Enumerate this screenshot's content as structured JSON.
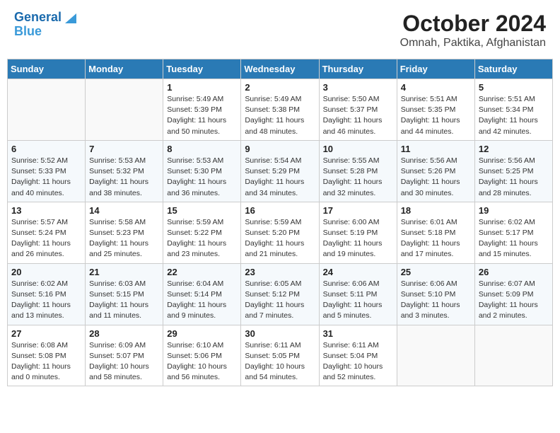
{
  "header": {
    "logo_line1": "General",
    "logo_line2": "Blue",
    "title": "October 2024",
    "subtitle": "Omnah, Paktika, Afghanistan"
  },
  "weekdays": [
    "Sunday",
    "Monday",
    "Tuesday",
    "Wednesday",
    "Thursday",
    "Friday",
    "Saturday"
  ],
  "weeks": [
    [
      {
        "day": "",
        "info": ""
      },
      {
        "day": "",
        "info": ""
      },
      {
        "day": "1",
        "info": "Sunrise: 5:49 AM\nSunset: 5:39 PM\nDaylight: 11 hours and 50 minutes."
      },
      {
        "day": "2",
        "info": "Sunrise: 5:49 AM\nSunset: 5:38 PM\nDaylight: 11 hours and 48 minutes."
      },
      {
        "day": "3",
        "info": "Sunrise: 5:50 AM\nSunset: 5:37 PM\nDaylight: 11 hours and 46 minutes."
      },
      {
        "day": "4",
        "info": "Sunrise: 5:51 AM\nSunset: 5:35 PM\nDaylight: 11 hours and 44 minutes."
      },
      {
        "day": "5",
        "info": "Sunrise: 5:51 AM\nSunset: 5:34 PM\nDaylight: 11 hours and 42 minutes."
      }
    ],
    [
      {
        "day": "6",
        "info": "Sunrise: 5:52 AM\nSunset: 5:33 PM\nDaylight: 11 hours and 40 minutes."
      },
      {
        "day": "7",
        "info": "Sunrise: 5:53 AM\nSunset: 5:32 PM\nDaylight: 11 hours and 38 minutes."
      },
      {
        "day": "8",
        "info": "Sunrise: 5:53 AM\nSunset: 5:30 PM\nDaylight: 11 hours and 36 minutes."
      },
      {
        "day": "9",
        "info": "Sunrise: 5:54 AM\nSunset: 5:29 PM\nDaylight: 11 hours and 34 minutes."
      },
      {
        "day": "10",
        "info": "Sunrise: 5:55 AM\nSunset: 5:28 PM\nDaylight: 11 hours and 32 minutes."
      },
      {
        "day": "11",
        "info": "Sunrise: 5:56 AM\nSunset: 5:26 PM\nDaylight: 11 hours and 30 minutes."
      },
      {
        "day": "12",
        "info": "Sunrise: 5:56 AM\nSunset: 5:25 PM\nDaylight: 11 hours and 28 minutes."
      }
    ],
    [
      {
        "day": "13",
        "info": "Sunrise: 5:57 AM\nSunset: 5:24 PM\nDaylight: 11 hours and 26 minutes."
      },
      {
        "day": "14",
        "info": "Sunrise: 5:58 AM\nSunset: 5:23 PM\nDaylight: 11 hours and 25 minutes."
      },
      {
        "day": "15",
        "info": "Sunrise: 5:59 AM\nSunset: 5:22 PM\nDaylight: 11 hours and 23 minutes."
      },
      {
        "day": "16",
        "info": "Sunrise: 5:59 AM\nSunset: 5:20 PM\nDaylight: 11 hours and 21 minutes."
      },
      {
        "day": "17",
        "info": "Sunrise: 6:00 AM\nSunset: 5:19 PM\nDaylight: 11 hours and 19 minutes."
      },
      {
        "day": "18",
        "info": "Sunrise: 6:01 AM\nSunset: 5:18 PM\nDaylight: 11 hours and 17 minutes."
      },
      {
        "day": "19",
        "info": "Sunrise: 6:02 AM\nSunset: 5:17 PM\nDaylight: 11 hours and 15 minutes."
      }
    ],
    [
      {
        "day": "20",
        "info": "Sunrise: 6:02 AM\nSunset: 5:16 PM\nDaylight: 11 hours and 13 minutes."
      },
      {
        "day": "21",
        "info": "Sunrise: 6:03 AM\nSunset: 5:15 PM\nDaylight: 11 hours and 11 minutes."
      },
      {
        "day": "22",
        "info": "Sunrise: 6:04 AM\nSunset: 5:14 PM\nDaylight: 11 hours and 9 minutes."
      },
      {
        "day": "23",
        "info": "Sunrise: 6:05 AM\nSunset: 5:12 PM\nDaylight: 11 hours and 7 minutes."
      },
      {
        "day": "24",
        "info": "Sunrise: 6:06 AM\nSunset: 5:11 PM\nDaylight: 11 hours and 5 minutes."
      },
      {
        "day": "25",
        "info": "Sunrise: 6:06 AM\nSunset: 5:10 PM\nDaylight: 11 hours and 3 minutes."
      },
      {
        "day": "26",
        "info": "Sunrise: 6:07 AM\nSunset: 5:09 PM\nDaylight: 11 hours and 2 minutes."
      }
    ],
    [
      {
        "day": "27",
        "info": "Sunrise: 6:08 AM\nSunset: 5:08 PM\nDaylight: 11 hours and 0 minutes."
      },
      {
        "day": "28",
        "info": "Sunrise: 6:09 AM\nSunset: 5:07 PM\nDaylight: 10 hours and 58 minutes."
      },
      {
        "day": "29",
        "info": "Sunrise: 6:10 AM\nSunset: 5:06 PM\nDaylight: 10 hours and 56 minutes."
      },
      {
        "day": "30",
        "info": "Sunrise: 6:11 AM\nSunset: 5:05 PM\nDaylight: 10 hours and 54 minutes."
      },
      {
        "day": "31",
        "info": "Sunrise: 6:11 AM\nSunset: 5:04 PM\nDaylight: 10 hours and 52 minutes."
      },
      {
        "day": "",
        "info": ""
      },
      {
        "day": "",
        "info": ""
      }
    ]
  ]
}
